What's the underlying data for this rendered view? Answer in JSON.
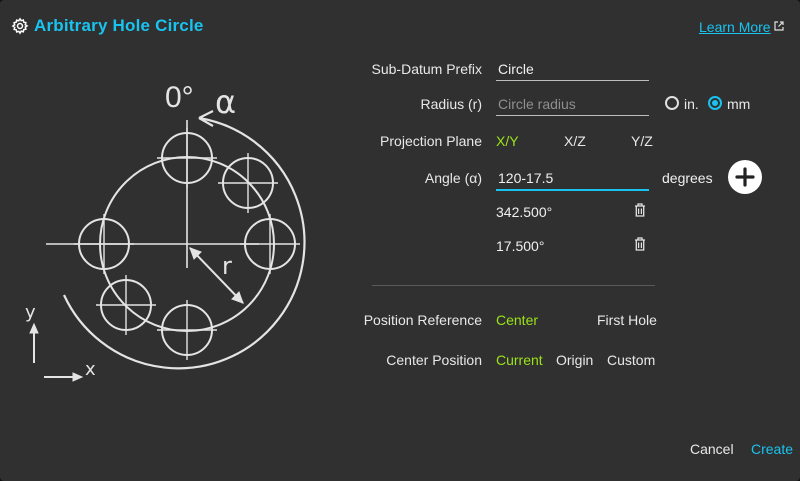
{
  "header": {
    "title": "Arbitrary Hole Circle",
    "learn_more": "Learn More"
  },
  "diagram": {
    "angle_zero": "0°",
    "alpha": "α",
    "radius_symbol": "r",
    "axis_y": "y",
    "axis_x": "x"
  },
  "form": {
    "sub_datum_prefix": {
      "label": "Sub-Datum Prefix",
      "value": "Circle"
    },
    "radius": {
      "label": "Radius (r)",
      "placeholder": "Circle radius",
      "value": "",
      "units": [
        "in.",
        "mm"
      ],
      "selected_unit": "mm"
    },
    "projection_plane": {
      "label": "Projection Plane",
      "options": [
        "X/Y",
        "X/Z",
        "Y/Z"
      ],
      "selected": "X/Y"
    },
    "angle": {
      "label": "Angle (α)",
      "value": "120-17.5",
      "units": "degrees"
    },
    "angles_list": [
      "342.500°",
      "17.500°"
    ],
    "position_reference": {
      "label": "Position Reference",
      "options": [
        "Center",
        "First Hole"
      ],
      "selected": "Center"
    },
    "center_position": {
      "label": "Center Position",
      "options": [
        "Current",
        "Origin",
        "Custom"
      ],
      "selected": "Current"
    }
  },
  "footer": {
    "cancel": "Cancel",
    "create": "Create"
  },
  "colors": {
    "accent": "#19c3f0",
    "selected": "#9be319",
    "background": "#303030"
  }
}
